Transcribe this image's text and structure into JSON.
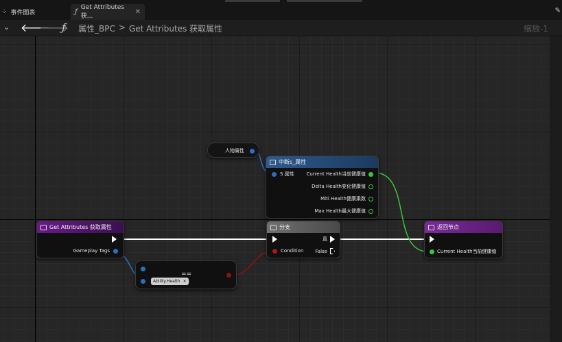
{
  "tabs": [
    {
      "label": "事件图表",
      "icon": "graph-icon"
    },
    {
      "label": "Get Attributes 获...",
      "icon": "function-icon",
      "close": "✕"
    }
  ],
  "toolbar": {
    "menu_label": "",
    "breadcrumb": [
      "属性_BPC",
      ">",
      "Get Attributes 获取属性"
    ],
    "zoom": "缩放-1"
  },
  "nodes": {
    "character_attr": {
      "label": "人物属性"
    },
    "break_struct": {
      "title": "中断s_属性",
      "input": "S 属性",
      "outputs": [
        "Current Health当前健康值",
        "Delta Health变化健康值",
        "Mlti Health健康乘数",
        "Max Health最大健康值"
      ]
    },
    "entry": {
      "title": "Get Attributes 获取属性",
      "output": "Gameplay Tags"
    },
    "branch": {
      "title": "分支",
      "true_label": "真",
      "condition": "Condition",
      "false_label": "False"
    },
    "return": {
      "title": "返回节点",
      "input": "Current Health当前健康值"
    },
    "equals": {
      "operator": "==",
      "tag_value": "Ability.Health",
      "tag_clear": "✕"
    }
  },
  "colors": {
    "exec": "#ffffff",
    "struct_pin": "#2a6fc0",
    "float_pin": "#3ec43e",
    "bool_pin": "#b01616",
    "function_header": "#6a1a8a",
    "break_header": "#2e5a8c"
  }
}
